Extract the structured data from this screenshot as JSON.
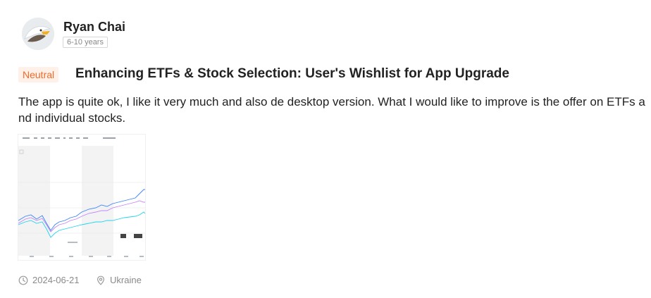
{
  "user": {
    "name": "Ryan Chai",
    "experience": "6-10 years",
    "avatar_icon": "eagle-avatar-icon"
  },
  "review": {
    "sentiment": "Neutral",
    "title": "Enhancing ETFs & Stock Selection: User's Wishlist for App Upgrade",
    "body": "The app is quite ok, I like it very much and also de desktop version. What I would like to improve is the offer on ETFs and individual stocks.",
    "date": "2024-06-21",
    "location": "Ukraine",
    "date_icon": "clock-icon",
    "location_icon": "location-pin-icon"
  },
  "colors": {
    "sentiment_text": "#f06a2c",
    "sentiment_bg": "#fff1e8",
    "meta_text": "#8a8a8a"
  }
}
